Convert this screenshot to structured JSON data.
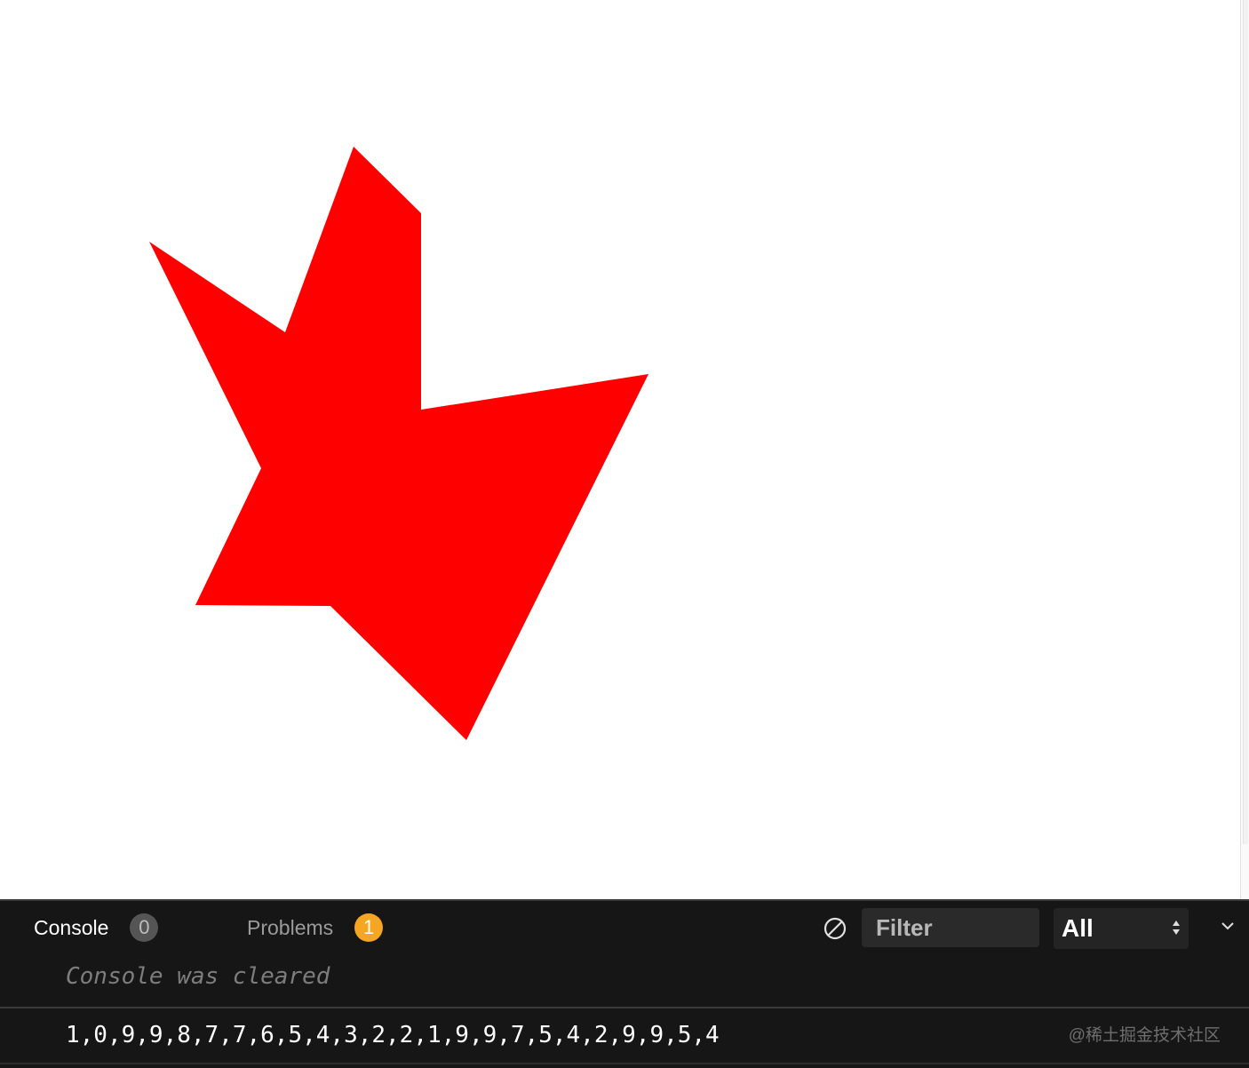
{
  "preview": {
    "shape_color": "#ff0000",
    "background": "#ffffff"
  },
  "devtools": {
    "tabs": {
      "console": {
        "label": "Console",
        "count": "0"
      },
      "problems": {
        "label": "Problems",
        "count": "1",
        "badge_color": "#f5a623"
      }
    },
    "filter": {
      "placeholder": "Filter",
      "value": ""
    },
    "level": {
      "selected": "All"
    },
    "icons": {
      "clear": "clear-console-icon",
      "level_arrows": "up-down-arrows-icon",
      "collapse": "chevron-down-icon"
    },
    "messages": {
      "cleared": "Console was cleared",
      "log": "1,0,9,9,8,7,7,6,5,4,3,2,2,1,9,9,7,5,4,2,9,9,5,4"
    }
  },
  "watermark": "@稀土掘金技术社区"
}
